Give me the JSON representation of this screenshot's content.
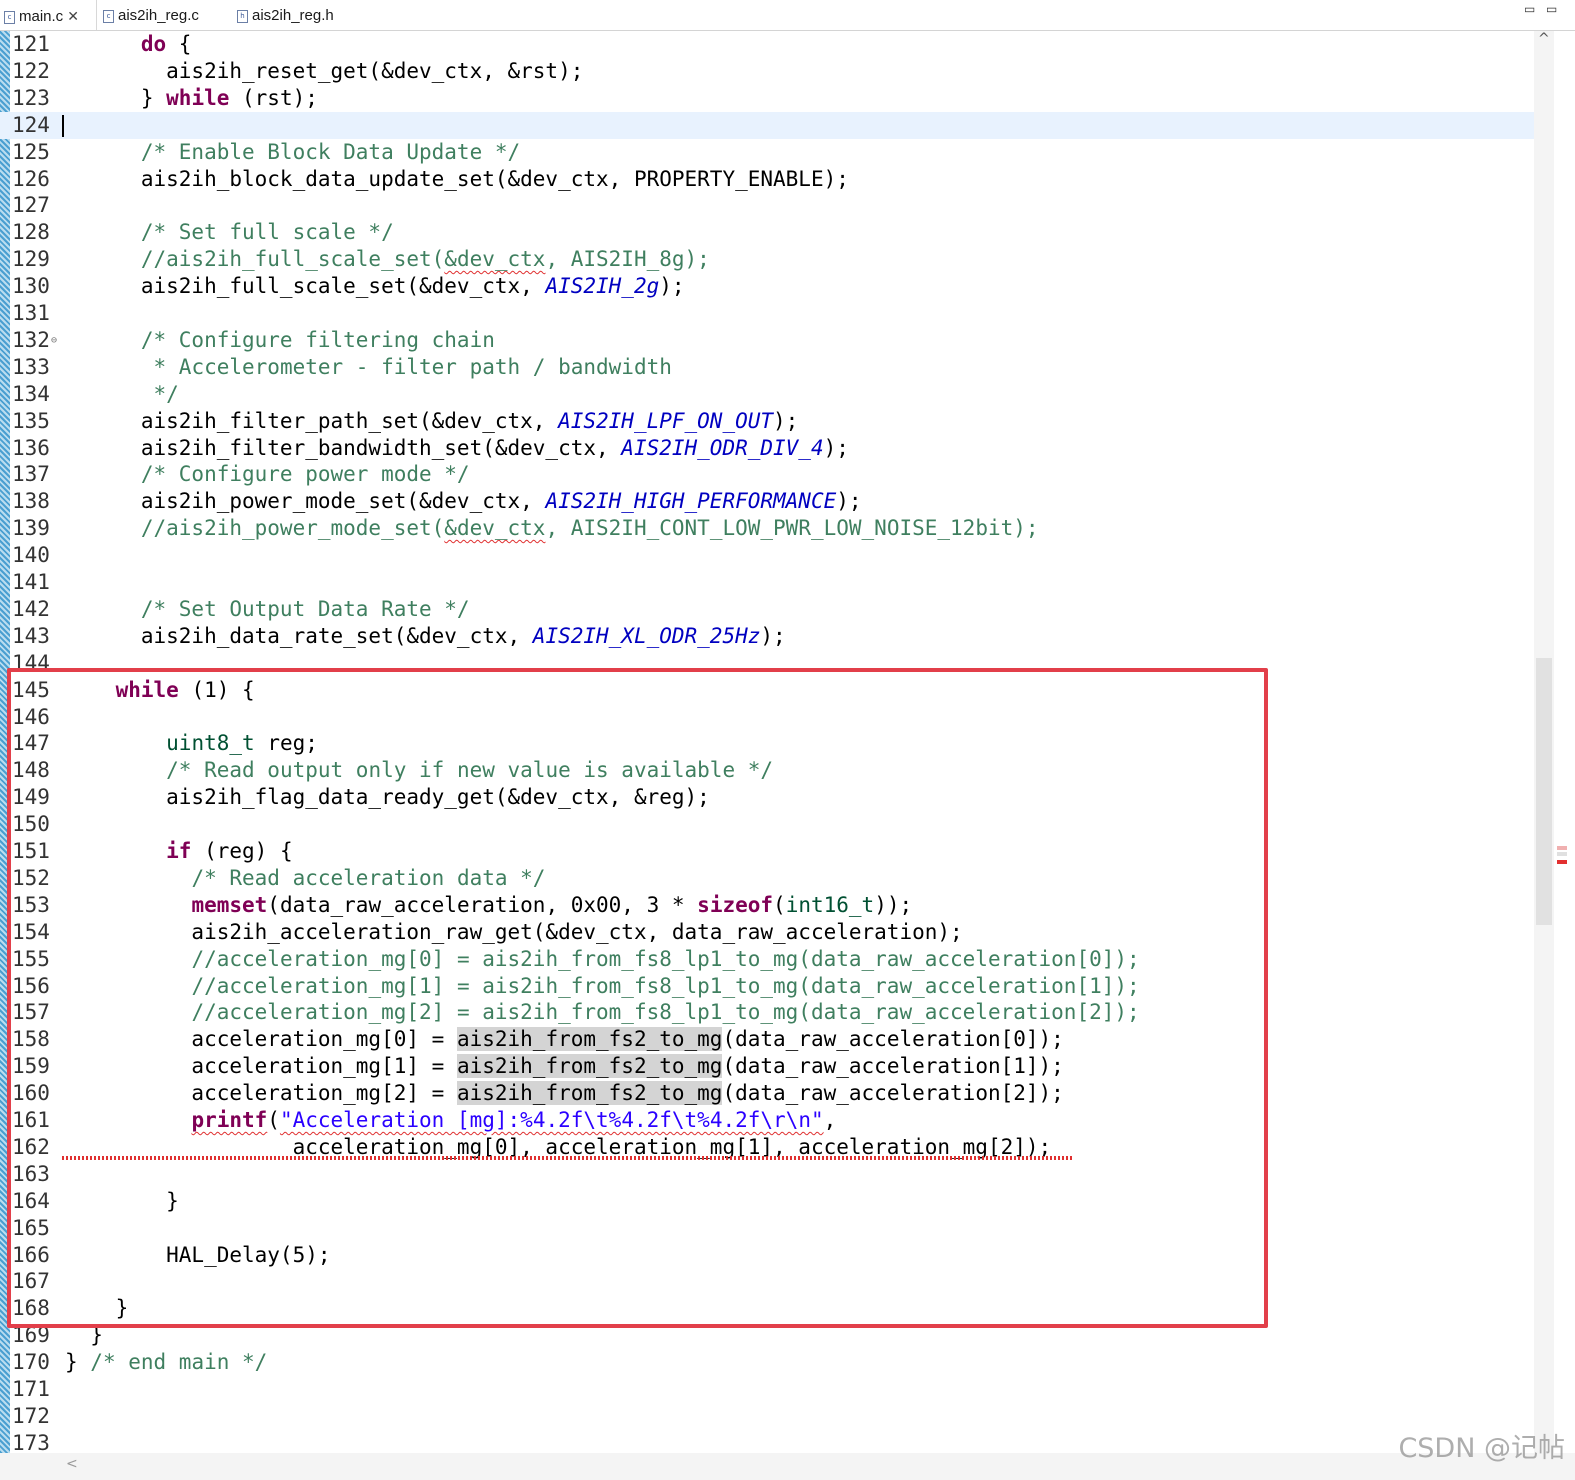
{
  "tabs": [
    {
      "label": "main.c",
      "icon": "c-file-icon",
      "active": true,
      "closable": true
    },
    {
      "label": "ais2ih_reg.c",
      "icon": "c-file-icon",
      "active": false
    },
    {
      "label": "ais2ih_reg.h",
      "icon": "h-file-icon",
      "active": false
    }
  ],
  "window_controls": {
    "minimize": "▭",
    "maximize": "▭"
  },
  "editor": {
    "current_line": 124,
    "highlight_box_lines": [
      145,
      168
    ],
    "highlight_box_color": "#e23f4a",
    "lines": [
      {
        "n": "121",
        "code": [
          [
            "      ",
            ""
          ],
          [
            "do",
            "kw"
          ],
          [
            " {",
            ""
          ]
        ]
      },
      {
        "n": "122",
        "code": [
          [
            "        ais2ih_reset_get(&dev_ctx, &rst);",
            ""
          ]
        ]
      },
      {
        "n": "123",
        "code": [
          [
            "      } ",
            ""
          ],
          [
            "while",
            "kw"
          ],
          [
            " (rst);",
            ""
          ]
        ]
      },
      {
        "n": "124",
        "code": []
      },
      {
        "n": "125",
        "code": [
          [
            "      ",
            ""
          ],
          [
            "/* Enable Block Data Update */",
            "cm"
          ]
        ]
      },
      {
        "n": "126",
        "code": [
          [
            "      ais2ih_block_data_update_set(&dev_ctx, PROPERTY_ENABLE);",
            ""
          ]
        ]
      },
      {
        "n": "127",
        "code": []
      },
      {
        "n": "128",
        "code": [
          [
            "      ",
            ""
          ],
          [
            "/* Set full scale */",
            "cm"
          ]
        ]
      },
      {
        "n": "129",
        "code": [
          [
            "      ",
            ""
          ],
          [
            "//ais2ih_full_scale_set(",
            "cm"
          ],
          [
            "&dev_ctx",
            "cm sq"
          ],
          [
            ", AIS2IH_8g);",
            "cm"
          ]
        ]
      },
      {
        "n": "130",
        "code": [
          [
            "      ais2ih_full_scale_set(&dev_ctx, ",
            ""
          ],
          [
            "AIS2IH_2g",
            "en"
          ],
          [
            ");",
            ""
          ]
        ]
      },
      {
        "n": "131",
        "code": []
      },
      {
        "n": "132",
        "code": [
          [
            "      ",
            ""
          ],
          [
            "/* Configure filtering chain",
            "cm"
          ]
        ],
        "fold": true
      },
      {
        "n": "133",
        "code": [
          [
            "       ",
            ""
          ],
          [
            "* Accelerometer - filter path / bandwidth",
            "cm"
          ]
        ]
      },
      {
        "n": "134",
        "code": [
          [
            "       ",
            ""
          ],
          [
            "*/",
            "cm"
          ]
        ]
      },
      {
        "n": "135",
        "code": [
          [
            "      ais2ih_filter_path_set(&dev_ctx, ",
            ""
          ],
          [
            "AIS2IH_LPF_ON_OUT",
            "en"
          ],
          [
            ");",
            ""
          ]
        ]
      },
      {
        "n": "136",
        "code": [
          [
            "      ais2ih_filter_bandwidth_set(&dev_ctx, ",
            ""
          ],
          [
            "AIS2IH_ODR_DIV_4",
            "en"
          ],
          [
            ");",
            ""
          ]
        ]
      },
      {
        "n": "137",
        "code": [
          [
            "      ",
            ""
          ],
          [
            "/* Configure power mode */",
            "cm"
          ]
        ]
      },
      {
        "n": "138",
        "code": [
          [
            "      ais2ih_power_mode_set(&dev_ctx, ",
            ""
          ],
          [
            "AIS2IH_HIGH_PERFORMANCE",
            "en"
          ],
          [
            ");",
            ""
          ]
        ]
      },
      {
        "n": "139",
        "code": [
          [
            "      ",
            ""
          ],
          [
            "//ais2ih_power_mode_set(",
            "cm"
          ],
          [
            "&dev_ctx",
            "cm sq"
          ],
          [
            ", AIS2IH_CONT_LOW_PWR_LOW_NOISE_12bit);",
            "cm"
          ]
        ]
      },
      {
        "n": "140",
        "code": []
      },
      {
        "n": "141",
        "code": []
      },
      {
        "n": "142",
        "code": [
          [
            "      ",
            ""
          ],
          [
            "/* Set Output Data Rate */",
            "cm"
          ]
        ]
      },
      {
        "n": "143",
        "code": [
          [
            "      ais2ih_data_rate_set(&dev_ctx, ",
            ""
          ],
          [
            "AIS2IH_XL_ODR_25Hz",
            "en"
          ],
          [
            ");",
            ""
          ]
        ]
      },
      {
        "n": "144",
        "code": []
      },
      {
        "n": "145",
        "code": [
          [
            "    ",
            ""
          ],
          [
            "while",
            "kw"
          ],
          [
            " (1) {",
            ""
          ]
        ]
      },
      {
        "n": "146",
        "code": []
      },
      {
        "n": "147",
        "code": [
          [
            "        ",
            ""
          ],
          [
            "uint8_t",
            "ty"
          ],
          [
            " reg;",
            ""
          ]
        ]
      },
      {
        "n": "148",
        "code": [
          [
            "        ",
            ""
          ],
          [
            "/* Read output only if new value is available */",
            "cm"
          ]
        ]
      },
      {
        "n": "149",
        "code": [
          [
            "        ais2ih_flag_data_ready_get(&dev_ctx, &reg);",
            ""
          ]
        ]
      },
      {
        "n": "150",
        "code": []
      },
      {
        "n": "151",
        "code": [
          [
            "        ",
            ""
          ],
          [
            "if",
            "kw"
          ],
          [
            " (reg) {",
            ""
          ]
        ]
      },
      {
        "n": "152",
        "code": [
          [
            "          ",
            ""
          ],
          [
            "/* Read acceleration data */",
            "cm"
          ]
        ]
      },
      {
        "n": "153",
        "code": [
          [
            "          ",
            ""
          ],
          [
            "memset",
            "kw"
          ],
          [
            "(data_raw_acceleration, 0x00, 3 * ",
            ""
          ],
          [
            "sizeof",
            "kw"
          ],
          [
            "(",
            ""
          ],
          [
            "int16_t",
            "ty"
          ],
          [
            "));",
            ""
          ]
        ]
      },
      {
        "n": "154",
        "code": [
          [
            "          ais2ih_acceleration_raw_get(&dev_ctx, data_raw_acceleration);",
            ""
          ]
        ]
      },
      {
        "n": "155",
        "code": [
          [
            "          ",
            ""
          ],
          [
            "//acceleration_mg[0] = ais2ih_from_fs8_lp1_to_mg(data_raw_acceleration[0]);",
            "cm"
          ]
        ]
      },
      {
        "n": "156",
        "code": [
          [
            "          ",
            ""
          ],
          [
            "//acceleration_mg[1] = ais2ih_from_fs8_lp1_to_mg(data_raw_acceleration[1]);",
            "cm"
          ]
        ]
      },
      {
        "n": "157",
        "code": [
          [
            "          ",
            ""
          ],
          [
            "//acceleration_mg[2] = ais2ih_from_fs8_lp1_to_mg(data_raw_acceleration[2]);",
            "cm"
          ]
        ]
      },
      {
        "n": "158",
        "code": [
          [
            "          acceleration_mg[0] = ",
            ""
          ],
          [
            "ais2ih_from_fs2_to_mg",
            "hl"
          ],
          [
            "(data_raw_acceleration[0]);",
            ""
          ]
        ]
      },
      {
        "n": "159",
        "code": [
          [
            "          acceleration_mg[1] = ",
            ""
          ],
          [
            "ais2ih_from_fs2_to_mg",
            "hl"
          ],
          [
            "(data_raw_acceleration[1]);",
            ""
          ]
        ]
      },
      {
        "n": "160",
        "code": [
          [
            "          acceleration_mg[2] = ",
            ""
          ],
          [
            "ais2ih_from_fs2_to_mg",
            "hl"
          ],
          [
            "(data_raw_acceleration[2]);",
            ""
          ]
        ]
      },
      {
        "n": "161",
        "code": [
          [
            "          ",
            ""
          ],
          [
            "printf",
            "kw sq"
          ],
          [
            "(",
            ""
          ],
          [
            "\"Acceleration [mg]:%4.2f\\t%4.2f\\t%4.2f\\r\\n\"",
            "st sq"
          ],
          [
            ",",
            ""
          ]
        ]
      },
      {
        "n": "162",
        "code": [
          [
            "                  acceleration_mg[0], acceleration_mg[1], acceleration_mg[2]);",
            ""
          ]
        ],
        "squiggle_line": true
      },
      {
        "n": "163",
        "code": []
      },
      {
        "n": "164",
        "code": [
          [
            "        }",
            ""
          ]
        ]
      },
      {
        "n": "165",
        "code": []
      },
      {
        "n": "166",
        "code": [
          [
            "        HAL_Delay(5);",
            ""
          ]
        ]
      },
      {
        "n": "167",
        "code": []
      },
      {
        "n": "168",
        "code": [
          [
            "    }",
            ""
          ]
        ]
      },
      {
        "n": "169",
        "code": [
          [
            "  }",
            ""
          ]
        ]
      },
      {
        "n": "170",
        "code": [
          [
            "} ",
            ""
          ],
          [
            "/* end main */",
            "cm"
          ]
        ]
      },
      {
        "n": "171",
        "code": []
      },
      {
        "n": "172",
        "code": []
      },
      {
        "n": "173",
        "code": []
      }
    ]
  },
  "scrollbar": {
    "up_arrow": "^",
    "left_arrow": "<"
  },
  "watermark": "CSDN @记帖",
  "colors": {
    "keyword": "#7f0055",
    "comment": "#3f7f5f",
    "enum": "#0000c0",
    "string": "#2a00ff",
    "type": "#005032",
    "current_line": "#e8f2fe"
  }
}
